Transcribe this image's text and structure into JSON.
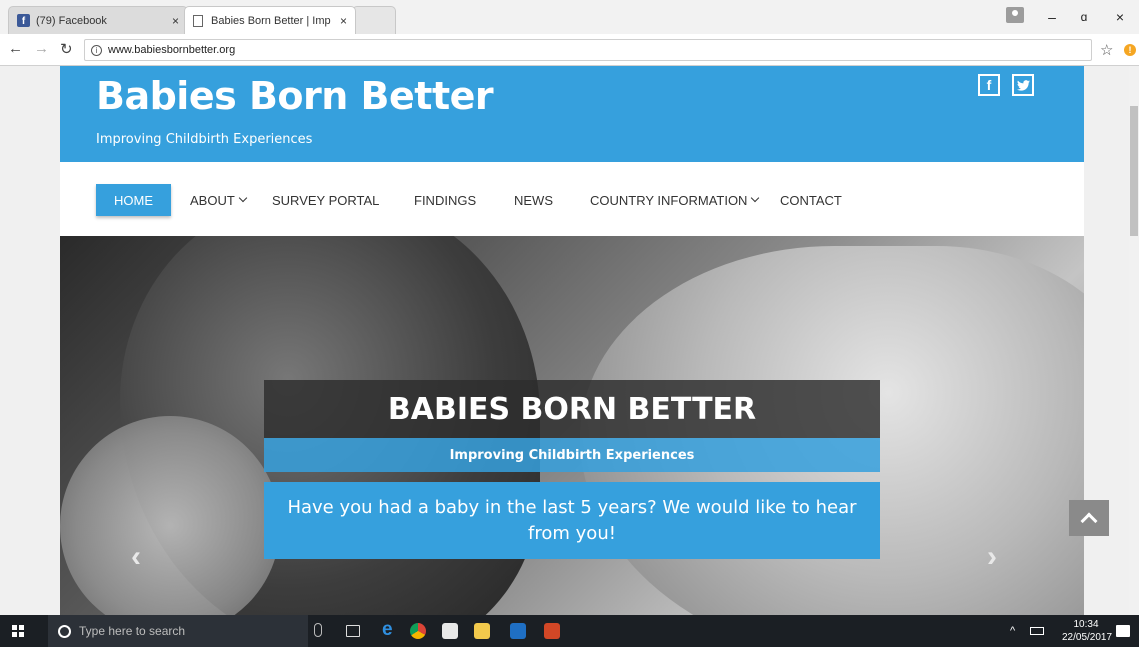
{
  "browser": {
    "tabs": [
      {
        "title": "(79) Facebook",
        "close": "×"
      },
      {
        "title": "Babies Born Better | Imp",
        "close": "×"
      }
    ],
    "url": "www.babiesbornbetter.org",
    "window_controls": {
      "minimize": "–",
      "maximize": "ɑ",
      "close": "×"
    }
  },
  "site": {
    "title": "Babies Born Better",
    "tagline": "Improving Childbirth Experiences",
    "social": {
      "facebook": "f",
      "twitter": "🐦"
    },
    "nav": [
      {
        "label": "HOME",
        "active": true
      },
      {
        "label": "ABOUT"
      },
      {
        "label": "SURVEY PORTAL"
      },
      {
        "label": "FINDINGS"
      },
      {
        "label": "NEWS"
      },
      {
        "label": "COUNTRY INFORMATION"
      },
      {
        "label": "CONTACT"
      }
    ],
    "hero": {
      "title": "BABIES BORN BETTER",
      "subtitle": "Improving Childbirth Experiences",
      "cta": "Have you had a baby in the last 5 years? We would like to hear from you!"
    }
  },
  "taskbar": {
    "search_placeholder": "Type here to search",
    "time": "10:34",
    "date": "22/05/2017"
  },
  "colors": {
    "accent": "#36a0dd",
    "taskbar": "#1b1f24"
  }
}
